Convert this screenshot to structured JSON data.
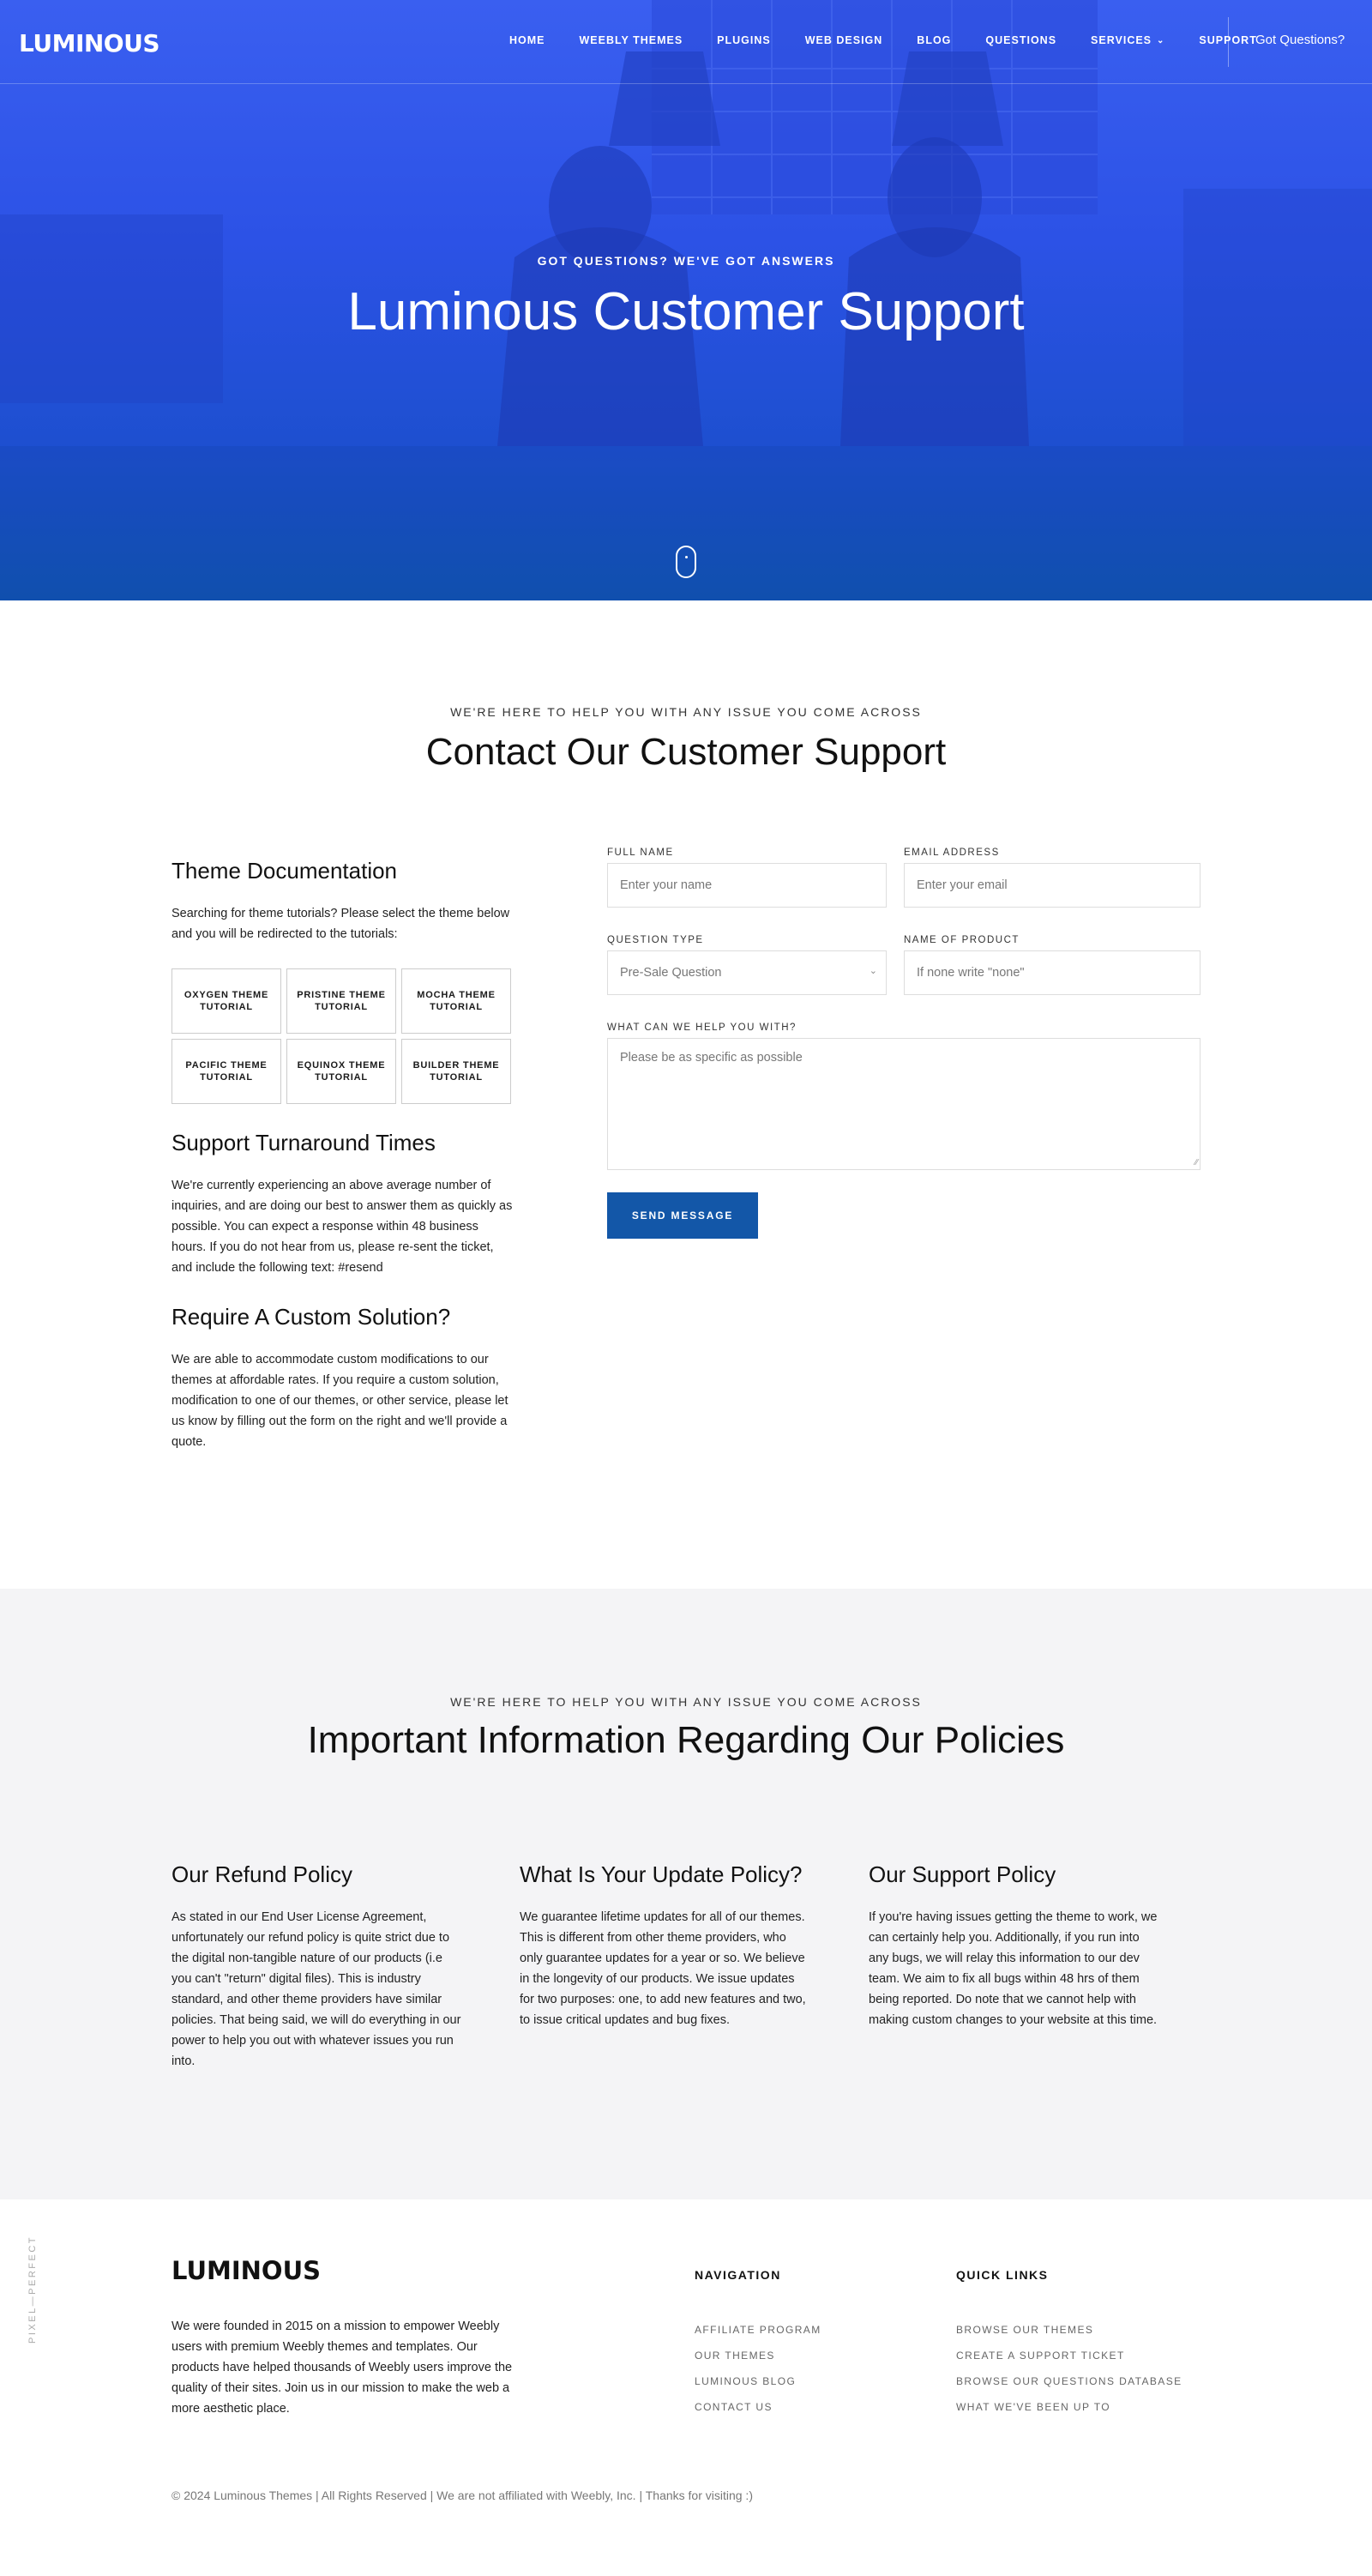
{
  "brand": {
    "logo": "LUMINOUS",
    "accent": "#2c52e6",
    "button_color": "#1357a8"
  },
  "nav": {
    "items": [
      {
        "label": "HOME"
      },
      {
        "label": "WEEBLY THEMES"
      },
      {
        "label": "PLUGINS"
      },
      {
        "label": "WEB DESIGN"
      },
      {
        "label": "BLOG"
      },
      {
        "label": "QUESTIONS"
      },
      {
        "label": "SERVICES",
        "icon": "chevron-down-icon"
      },
      {
        "label": "SUPPORT"
      }
    ],
    "cta": "Got Questions?"
  },
  "hero": {
    "kicker": "GOT QUESTIONS? WE'VE GOT ANSWERS",
    "title": "Luminous Customer Support",
    "scroll_icon": "mouse-scroll-icon"
  },
  "contact": {
    "kicker": "WE'RE HERE TO HELP YOU WITH ANY ISSUE YOU COME ACROSS",
    "title": "Contact Our Customer Support",
    "docs": {
      "title": "Theme Documentation",
      "text": "Searching for theme tutorials? Please select the theme below and you will be redirected to the tutorials:",
      "themes": [
        "OXYGEN THEME TUTORIAL",
        "PRISTINE THEME TUTORIAL",
        "MOCHA THEME TUTORIAL",
        "PACIFIC THEME TUTORIAL",
        "EQUINOX THEME TUTORIAL",
        "BUILDER THEME TUTORIAL"
      ]
    },
    "turnaround": {
      "title": "Support Turnaround Times",
      "text": "We're currently experiencing an above average number of inquiries, and are doing our best to answer them as quickly as possible. You can expect a response within 48 business hours. If you do not hear from us, please re-sent the ticket, and include the following text: #resend"
    },
    "custom": {
      "title": "Require A Custom Solution?",
      "text": "We are able to accommodate custom modifications to our themes at affordable rates. If you require a custom solution, modification to one of our themes, or other service, please let us know by filling out the form on the right and we'll provide a quote."
    },
    "form": {
      "full_name_label": "FULL NAME",
      "full_name_placeholder": "Enter your name",
      "email_label": "EMAIL ADDRESS",
      "email_placeholder": "Enter your email",
      "question_type_label": "QUESTION TYPE",
      "question_type_value": "Pre-Sale Question",
      "product_label": "NAME OF PRODUCT",
      "product_placeholder": "If none write \"none\"",
      "message_label": "WHAT CAN WE HELP YOU WITH?",
      "message_placeholder": "Please be as specific as possible",
      "submit": "SEND MESSAGE"
    }
  },
  "policies": {
    "kicker": "WE'RE HERE TO HELP YOU WITH ANY ISSUE YOU COME ACROSS",
    "title": "Important Information Regarding Our Policies",
    "items": [
      {
        "title": "Our Refund Policy",
        "text": "As stated in our End User License Agreement, unfortunately our refund policy is quite strict due to the digital non-tangible nature of our products (i.e you can't \"return\" digital files). This is industry standard, and other theme providers have similar policies. That being said, we will do everything in our power to help you out with whatever issues you run into."
      },
      {
        "title": "What Is Your Update Policy?",
        "text": "We guarantee lifetime updates for all of our themes. This is different from other theme providers, who only guarantee updates for a year or so. We believe in the longevity of our products. We issue updates for two purposes: one, to add new features and two, to issue critical updates and bug fixes."
      },
      {
        "title": "Our Support Policy",
        "text": "If you're having issues getting the theme to work, we can certainly help you. Additionally, if you run into any bugs, we will relay this information to our dev team. We aim to fix all bugs within 48 hrs of them being reported. Do note that we cannot help with making custom changes to your website at this time."
      }
    ]
  },
  "footer": {
    "logo": "LUMINOUS",
    "about": "We were founded in 2015 on a mission to empower Weebly users with premium Weebly themes and templates. Our products have helped thousands of Weebly users improve the quality of their sites. Join us in our mission to make the web a more aesthetic place.",
    "nav_title": "NAVIGATION",
    "nav_links": [
      "AFFILIATE PROGRAM",
      "OUR THEMES",
      "LUMINOUS BLOG",
      "CONTACT US"
    ],
    "quick_title": "QUICK LINKS",
    "quick_links": [
      "BROWSE OUR THEMES",
      "CREATE A SUPPORT TICKET",
      "BROWSE OUR QUESTIONS DATABASE",
      "WHAT WE'VE BEEN UP TO"
    ],
    "copyright": "© 2024 Luminous Themes | All Rights Reserved | We are not affiliated with Weebly, Inc. | Thanks for visiting :)",
    "side_tag": "PIXEL—PERFECT"
  }
}
